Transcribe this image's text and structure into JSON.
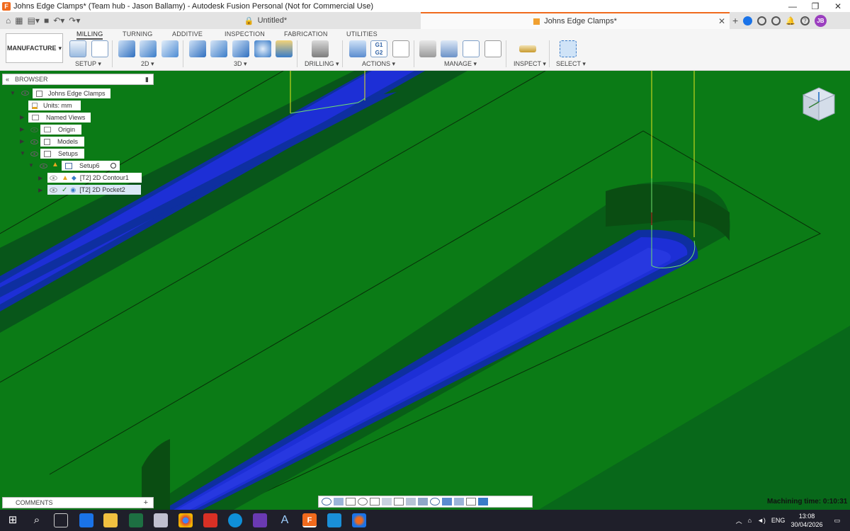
{
  "window": {
    "title": "Johns Edge Clamps* (Team hub - Jason Ballamy) - Autodesk Fusion Personal (Not for Commercial Use)"
  },
  "tabs": [
    {
      "label": "Untitled*"
    },
    {
      "label": "Johns Edge Clamps*"
    }
  ],
  "user": {
    "initials": "JB"
  },
  "ribbon": {
    "workspace": "MANUFACTURE",
    "tabs": [
      "MILLING",
      "TURNING",
      "ADDITIVE",
      "INSPECTION",
      "FABRICATION",
      "UTILITIES"
    ],
    "groups": [
      "SETUP",
      "2D",
      "3D",
      "DRILLING",
      "ACTIONS",
      "MANAGE",
      "INSPECT",
      "SELECT"
    ]
  },
  "browser": {
    "title": "BROWSER",
    "nodes": [
      "Johns Edge Clamps",
      "Units: mm",
      "Named Views",
      "Origin",
      "Models",
      "Setups",
      "Setup6",
      "[T2] 2D Contour1",
      "[T2] 2D Pocket2"
    ]
  },
  "comments": {
    "label": "COMMENTS"
  },
  "status": {
    "machining_time": "Machining time: 0:10:31"
  },
  "taskbar": {
    "lang": "ENG",
    "time": "13:08",
    "date": "30/04/2026"
  },
  "colors": {
    "stock": "#0b7b16",
    "toolpath": "#1d2fd6",
    "accent": "#f06a1d"
  }
}
